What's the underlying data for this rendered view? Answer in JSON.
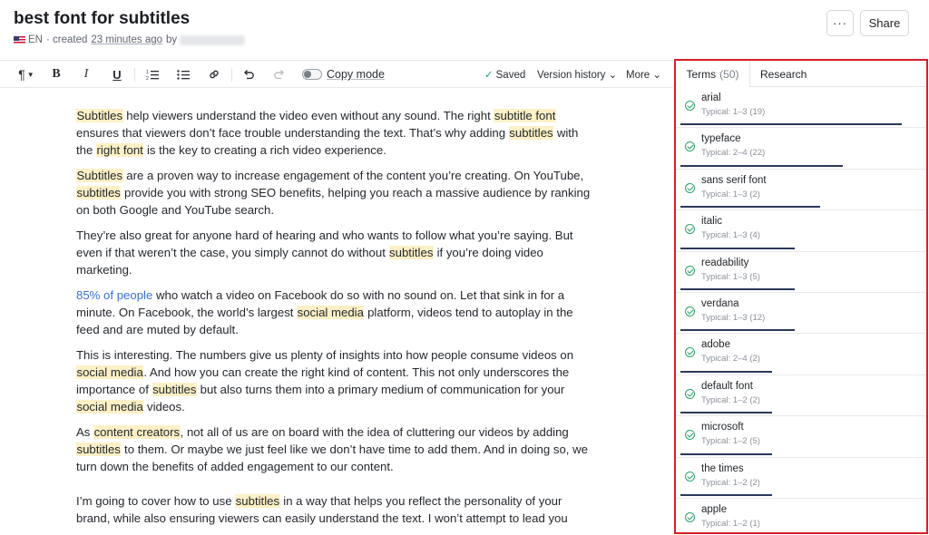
{
  "header": {
    "title": "best font for subtitles",
    "lang": "EN",
    "created_prefix": "· created",
    "created_ago": "23 minutes ago",
    "created_by": "by",
    "more_label": "···",
    "share_label": "Share"
  },
  "toolbar": {
    "paragraph_icon": "paragraph-icon",
    "bold": "B",
    "italic": "I",
    "underline": "U",
    "copy_mode_label": "Copy mode",
    "saved_label": "Saved",
    "version_history_label": "Version history ⌄",
    "more_label": "More ⌄"
  },
  "editor": {
    "paragraphs": [
      [
        {
          "t": "Subtitles",
          "h": true
        },
        {
          "t": " help viewers understand the video even without any sound. The right "
        },
        {
          "t": "subtitle font",
          "h": true
        },
        {
          "t": " ensures that viewers don’t face trouble understanding the text. That’s why adding "
        },
        {
          "t": "subtitles",
          "h": true
        },
        {
          "t": " with the "
        },
        {
          "t": "right font",
          "h": true
        },
        {
          "t": " is the key to creating a rich video experience."
        }
      ],
      [
        {
          "t": "Subtitles",
          "h": true
        },
        {
          "t": " are a proven way to increase engagement of the content you’re creating. On YouTube, "
        },
        {
          "t": "subtitles",
          "h": true
        },
        {
          "t": " provide you with strong SEO benefits, helping you reach a massive audience by ranking on both Google and YouTube search."
        }
      ],
      [
        {
          "t": "They’re also great for anyone hard of hearing and who wants to follow what you’re saying. But even if that weren’t the case, you simply cannot do without "
        },
        {
          "t": "subtitles",
          "h": true
        },
        {
          "t": " if you’re doing video marketing."
        }
      ],
      [
        {
          "t": "85% of people",
          "link": true
        },
        {
          "t": " who watch a video on Facebook do so with no sound on. Let that sink in for a minute. On Facebook, the world’s largest "
        },
        {
          "t": "social media",
          "h": true
        },
        {
          "t": " platform, videos tend to autoplay in the feed and are muted by default."
        }
      ],
      [
        {
          "t": "This is interesting. The numbers give us plenty of insights into how people consume videos on "
        },
        {
          "t": "social media",
          "h": true
        },
        {
          "t": ". And how you can create the right kind of content. This not only underscores the importance of "
        },
        {
          "t": "subtitles",
          "h": true
        },
        {
          "t": " but also turns them into a primary medium of communication for your "
        },
        {
          "t": "social media",
          "h": true
        },
        {
          "t": " videos."
        }
      ],
      [
        {
          "t": "As "
        },
        {
          "t": "content creators",
          "h": true
        },
        {
          "t": ", not all of us are on board with the idea of cluttering our videos by adding "
        },
        {
          "t": "subtitles",
          "h": true
        },
        {
          "t": " to them. Or maybe we just feel like we don’t have time to add them. And in doing so, we turn down the benefits of added engagement to our content."
        }
      ],
      [
        {
          "t": "I’m going to cover how to use "
        },
        {
          "t": "subtitles",
          "h": true
        },
        {
          "t": " in a way that helps you reflect the personality of your brand, while also ensuring viewers can easily understand the text. I won’t attempt to lead you"
        }
      ]
    ]
  },
  "panel": {
    "tab_terms_label": "Terms",
    "tab_terms_count": "(50)",
    "tab_research_label": "Research",
    "terms": [
      {
        "name": "arial",
        "typical": "Typical: 1–3 (19)",
        "progress": 0.97
      },
      {
        "name": "typeface",
        "typical": "Typical: 2–4 (22)",
        "progress": 0.71
      },
      {
        "name": "sans serif font",
        "typical": "Typical: 1–3 (2)",
        "progress": 0.61
      },
      {
        "name": "italic",
        "typical": "Typical: 1–3 (4)",
        "progress": 0.5
      },
      {
        "name": "readability",
        "typical": "Typical: 1–3 (5)",
        "progress": 0.5
      },
      {
        "name": "verdana",
        "typical": "Typical: 1–3 (12)",
        "progress": 0.5
      },
      {
        "name": "adobe",
        "typical": "Typical: 2–4 (2)",
        "progress": 0.4
      },
      {
        "name": "default font",
        "typical": "Typical: 1–2 (2)",
        "progress": 0.4
      },
      {
        "name": "microsoft",
        "typical": "Typical: 1–2 (5)",
        "progress": 0.4
      },
      {
        "name": "the times",
        "typical": "Typical: 1–2 (2)",
        "progress": 0.4
      },
      {
        "name": "apple",
        "typical": "Typical: 1–2 (1)",
        "progress": 0.3
      }
    ]
  },
  "colors": {
    "highlight": "#fdf0c5",
    "accent_green": "#27a36a",
    "panel_border": "#d61e2b",
    "link": "#3b6fd0"
  }
}
